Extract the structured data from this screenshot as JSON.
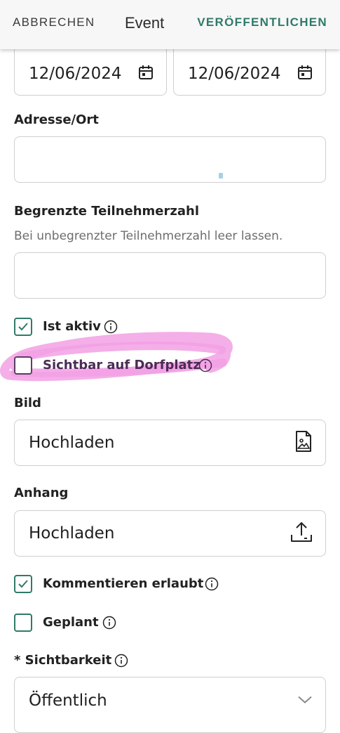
{
  "header": {
    "cancel_label": "ABBRECHEN",
    "title": "Event",
    "publish_label": "VERÖFFENTLICHEN"
  },
  "dates": {
    "start": "12/06/2024",
    "end": "12/06/2024"
  },
  "address": {
    "label": "Adresse/Ort",
    "value": ""
  },
  "participants": {
    "label": "Begrenzte Teilnehmerzahl",
    "hint": "Bei unbegrenzter Teilnehmerzahl leer lassen.",
    "value": ""
  },
  "options": {
    "is_active": {
      "label": "Ist aktiv",
      "checked": true
    },
    "visible_dorfplatz": {
      "label": "Sichtbar auf Dorfplatz",
      "checked": false
    }
  },
  "image": {
    "label": "Bild",
    "button": "Hochladen"
  },
  "attachment": {
    "label": "Anhang",
    "button": "Hochladen"
  },
  "options2": {
    "comments_allowed": {
      "label": "Kommentieren erlaubt",
      "checked": true
    },
    "planned": {
      "label": "Geplant",
      "checked": false
    }
  },
  "visibility": {
    "label": "* Sichtbarkeit",
    "selected": "Öffentlich"
  },
  "colors": {
    "accent": "#2f7a69",
    "highlight": "#f2a0e4"
  }
}
